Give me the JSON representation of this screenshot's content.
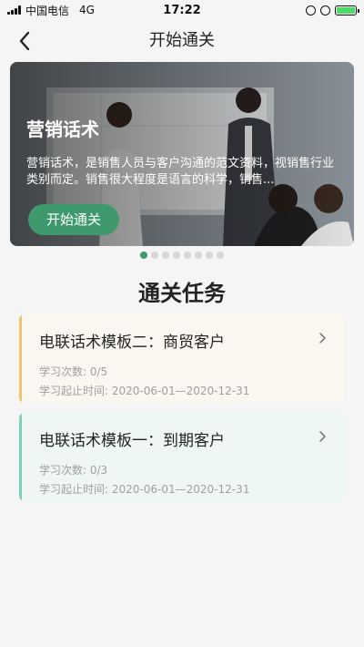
{
  "status_bar": {
    "carrier": "中国电信",
    "network": "4G",
    "time": "17:22"
  },
  "nav": {
    "title": "开始通关",
    "back_icon": "chevron-left-icon"
  },
  "banner": {
    "title": "营销话术",
    "description": "营销话术，是销售人员与客户沟通的范文资料，视销售行业类别而定。销售很大程度是语言的科学，销售...",
    "button_label": "开始通关"
  },
  "carousel": {
    "total": 8,
    "active_index": 0
  },
  "section_title": "通关任务",
  "tasks": [
    {
      "name": "电联话术模板二：商贸客户",
      "count_label": "学习次数: 0/5",
      "period_label": "学习起止时间: 2020-06-01—2020-12-31",
      "accent": "#f0c36d",
      "background": "#faf7f0"
    },
    {
      "name": "电联话术模板一：到期客户",
      "count_label": "学习次数: 0/3",
      "period_label": "学习起止时间: 2020-06-01—2020-12-31",
      "accent": "#7fd0b8",
      "background": "#eef7f5"
    }
  ],
  "colors": {
    "primary": "#3e9a6c",
    "battery": "#4cd964"
  }
}
